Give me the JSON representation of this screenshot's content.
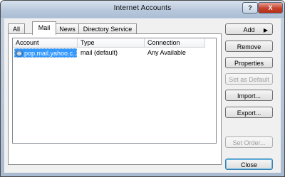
{
  "window": {
    "title": "Internet Accounts",
    "help_label": "?",
    "close_label": "X"
  },
  "tabs": [
    {
      "label": "All"
    },
    {
      "label": "Mail"
    },
    {
      "label": "News"
    },
    {
      "label": "Directory Service"
    }
  ],
  "list": {
    "columns": [
      "Account",
      "Type",
      "Connection"
    ],
    "rows": [
      {
        "account": "pop.mail.yahoo.c...",
        "type": "mail (default)",
        "connection": "Any Available"
      }
    ]
  },
  "buttons": {
    "add": "Add",
    "add_arrow": "▶",
    "remove": "Remove",
    "properties": "Properties",
    "set_default": "Set as Default",
    "import": "Import...",
    "export": "Export...",
    "set_order": "Set Order...",
    "close": "Close"
  },
  "colors": {
    "selection": "#3399ff",
    "titlebar": "#b9c9dc",
    "close_button": "#c5412c"
  }
}
